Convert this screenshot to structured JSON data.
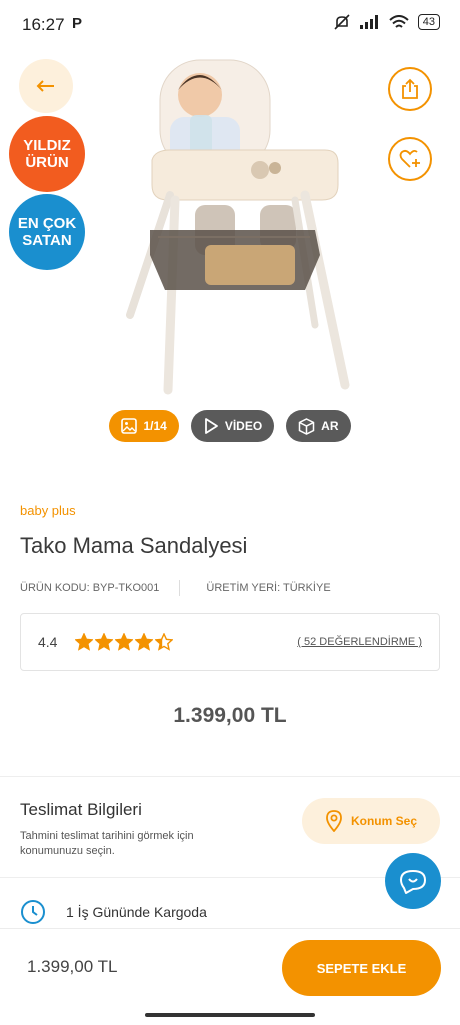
{
  "status_bar": {
    "time": "16:27",
    "app_letter": "P",
    "battery": "43"
  },
  "badges": {
    "star_line1": "YILDIZ",
    "star_line2": "ÜRÜN",
    "best_line1": "EN ÇOK",
    "best_line2": "SATAN"
  },
  "media": {
    "gallery": "1/14",
    "video": "VİDEO",
    "ar": "AR"
  },
  "product": {
    "brand": "baby plus",
    "title": "Tako Mama Sandalyesi",
    "code": "ÜRÜN KODU: BYP-TKO001",
    "origin": "ÜRETİM YERİ: TÜRKİYE",
    "rating": "4.4",
    "rating_value": 4.4,
    "stars_max": 5,
    "reviews": "( 52 DEĞERLENDİRME )",
    "price": "1.399,00 TL"
  },
  "delivery": {
    "title": "Teslimat Bilgileri",
    "desc": "Tahmini teslimat tarihini görmek için konumunuzu seçin.",
    "location_button": "Konum Seç",
    "shipping": "1 İş Gününde Kargoda"
  },
  "bottom": {
    "price": "1.399,00 TL",
    "cart_button": "SEPETE EKLE"
  },
  "colors": {
    "accent": "#f39200",
    "blue": "#1a8fcf",
    "orange_badge": "#f25c1f"
  },
  "icons": [
    "back-arrow-icon",
    "share-icon",
    "heart-add-icon",
    "image-icon",
    "play-icon",
    "cube-icon",
    "location-pin-icon",
    "chat-icon",
    "clock-icon",
    "star-icon"
  ]
}
